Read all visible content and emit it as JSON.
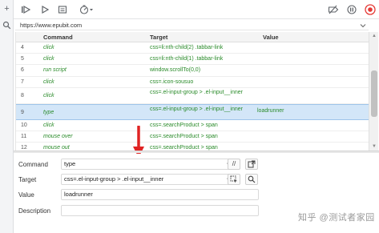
{
  "url": "https://www.epubit.com",
  "columns": {
    "command": "Command",
    "target": "Target",
    "value": "Value"
  },
  "rows": [
    {
      "num": "4",
      "command": "click",
      "target": "css=li:nth-child(2) .tabbar-link",
      "value": ""
    },
    {
      "num": "5",
      "command": "click",
      "target": "css=li:nth-child(1) .tabbar-link",
      "value": ""
    },
    {
      "num": "6",
      "command": "run script",
      "target": "window.scrollTo(0,0)",
      "value": ""
    },
    {
      "num": "7",
      "command": "click",
      "target": "css=.icon-sousuo",
      "value": ""
    },
    {
      "num": "8",
      "command": "click",
      "target": "css=.el-input-group > .el-input__inner",
      "value": ""
    },
    {
      "num": "9",
      "command": "type",
      "target": "css=.el-input-group > .el-input__inner",
      "value": "loadrunner"
    },
    {
      "num": "10",
      "command": "click",
      "target": "css=.searchProduct > span",
      "value": ""
    },
    {
      "num": "11",
      "command": "mouse over",
      "target": "css=.searchProduct > span",
      "value": ""
    },
    {
      "num": "12",
      "command": "mouse out",
      "target": "css=.searchProduct > span",
      "value": ""
    }
  ],
  "editor": {
    "command_label": "Command",
    "command_value": "type",
    "target_label": "Target",
    "target_value": "css=.el-input-group > .el-input__inner",
    "value_label": "Value",
    "value_value": "loadrunner",
    "description_label": "Description",
    "description_value": "",
    "comment_button": "//"
  },
  "rail": {
    "add": "+"
  },
  "watermark": "知乎 @测试者家园",
  "colors": {
    "command_text": "#2a8b2a",
    "selected_row": "#d3e6f8",
    "record_button": "#e53935",
    "arrow": "#e02424"
  },
  "icons": [
    "add-icon",
    "search-icon",
    "step-over-icon",
    "play-icon",
    "playlist-icon",
    "speed-icon",
    "disable-breakpoints-icon",
    "pause-on-exception-icon",
    "record-icon",
    "chevron-down-icon",
    "open-in-page-icon",
    "find-in-page-icon"
  ]
}
